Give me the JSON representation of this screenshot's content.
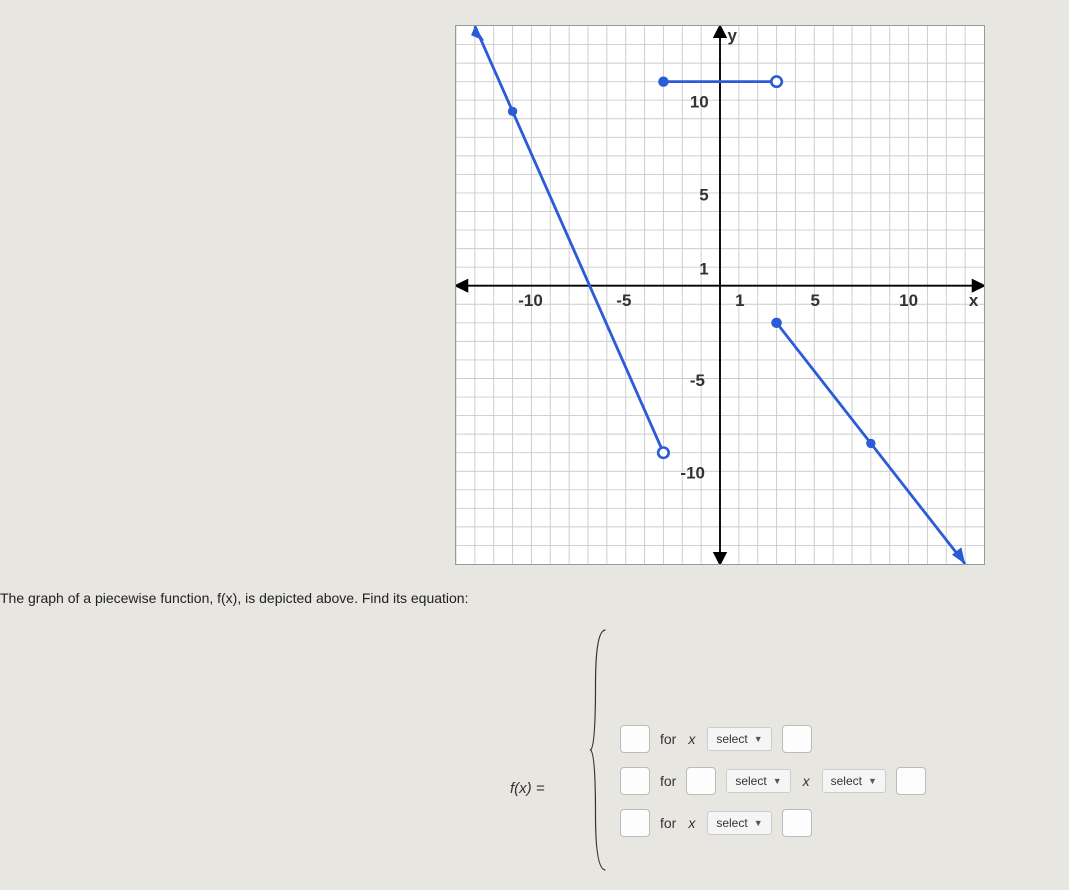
{
  "prompt_text": "The graph of a piecewise function, f(x), is depicted above. Find its equation:",
  "fx_label": "f(x) = ",
  "axis": {
    "x_ticks": {
      "neg10": "-10",
      "neg5": "-5",
      "one": "1",
      "five": "5",
      "ten": "10"
    },
    "y_ticks": {
      "ten": "10",
      "five": "5",
      "one": "1",
      "neg5": "-5",
      "neg10": "-10"
    },
    "x_label": "x",
    "y_label": "y"
  },
  "rows": {
    "r1": {
      "for": "for",
      "var": "x",
      "select": "select"
    },
    "r2": {
      "for": "for",
      "var": "x",
      "select1": "select",
      "select2": "select"
    },
    "r3": {
      "for": "for",
      "var": "x",
      "select": "select"
    }
  },
  "chart_data": {
    "type": "line",
    "title": "",
    "xlabel": "x",
    "ylabel": "y",
    "xlim": [
      -14,
      14
    ],
    "ylim": [
      -15,
      14
    ],
    "series": [
      {
        "name": "piece1",
        "points": [
          [
            -13,
            14
          ],
          [
            -3,
            -9
          ]
        ],
        "left_arrow": true,
        "right_open": true
      },
      {
        "name": "piece2",
        "points": [
          [
            -3,
            11
          ],
          [
            3,
            11
          ]
        ],
        "left_closed": true,
        "right_open": true
      },
      {
        "name": "piece3",
        "points": [
          [
            3,
            -2
          ],
          [
            13,
            -15
          ]
        ],
        "left_closed": true,
        "right_arrow": true
      }
    ]
  }
}
